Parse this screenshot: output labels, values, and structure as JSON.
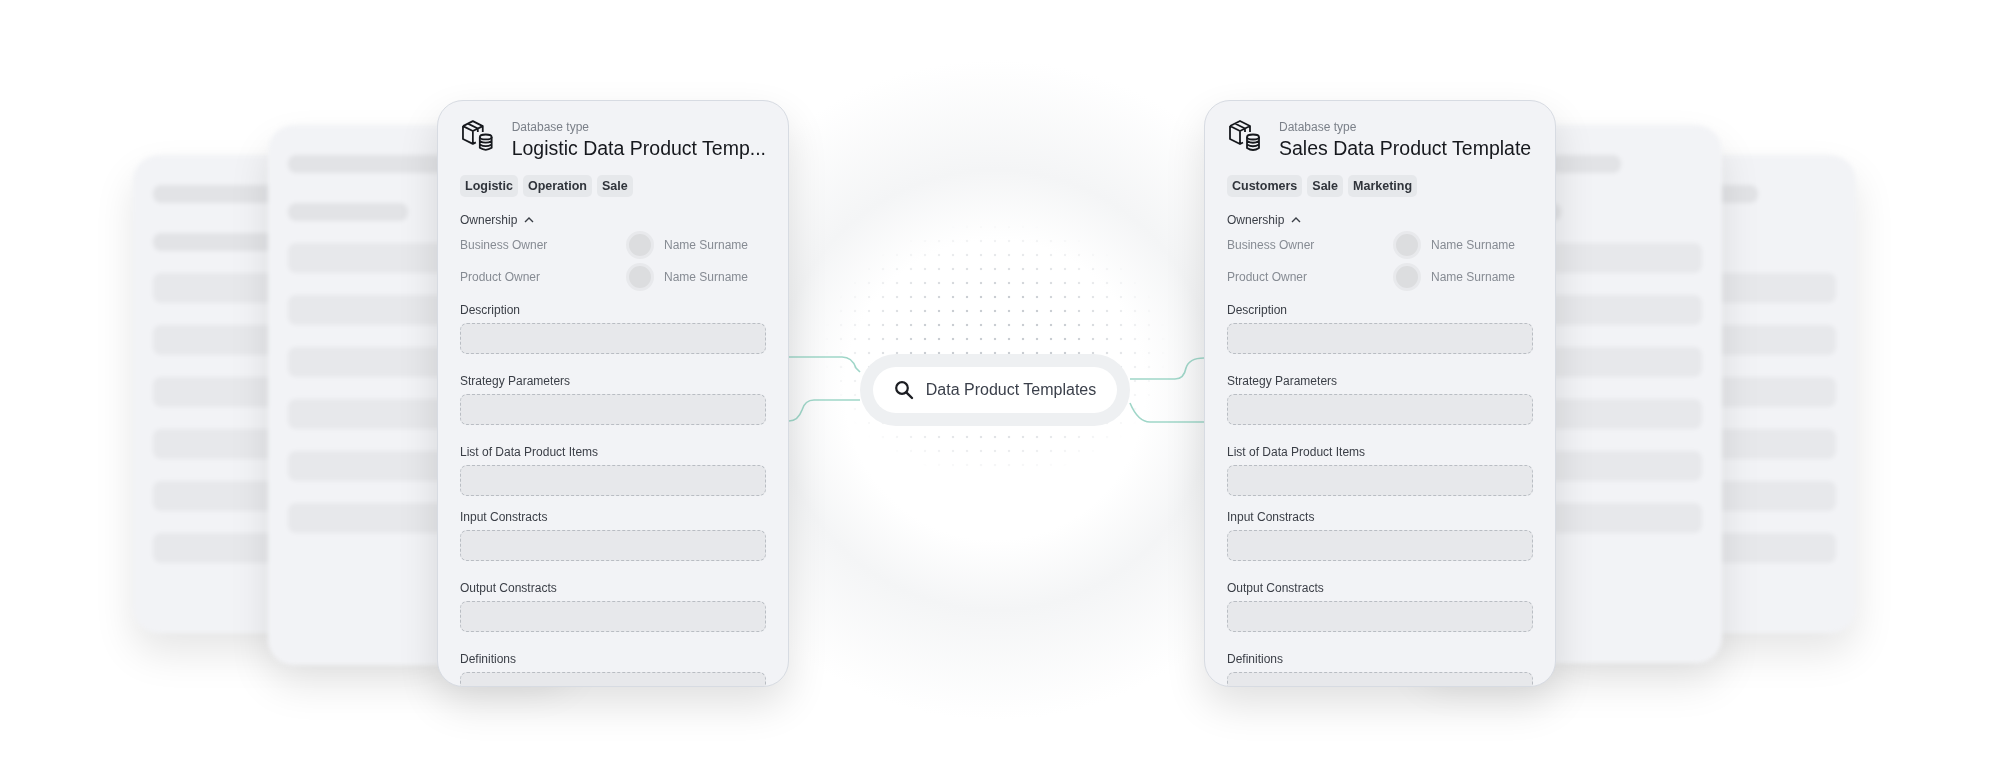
{
  "center_search": {
    "label": "Data Product Templates"
  },
  "cards": [
    {
      "subtitle": "Database type",
      "title": "Logistic Data Product Temp...",
      "tags": [
        "Logistic",
        "Operation",
        "Sale"
      ],
      "ownership": {
        "label": "Ownership",
        "expanded": true,
        "owners": [
          {
            "role": "Business Owner",
            "name": "Name Surname"
          },
          {
            "role": "Product Owner",
            "name": "Name Surname"
          }
        ]
      },
      "fields": [
        "Description",
        "Strategy Parameters",
        "List of Data Product Items",
        "Input Constracts",
        "Output Constracts",
        "Definitions"
      ]
    },
    {
      "subtitle": "Database type",
      "title": "Sales Data Product Template",
      "tags": [
        "Customers",
        "Sale",
        "Marketing"
      ],
      "ownership": {
        "label": "Ownership",
        "expanded": true,
        "owners": [
          {
            "role": "Business Owner",
            "name": "Name Surname"
          },
          {
            "role": "Product Owner",
            "name": "Name Surname"
          }
        ]
      },
      "fields": [
        "Description",
        "Strategy Parameters",
        "List of Data Product Items",
        "Input Constracts",
        "Output Constracts",
        "Definitions"
      ]
    }
  ]
}
